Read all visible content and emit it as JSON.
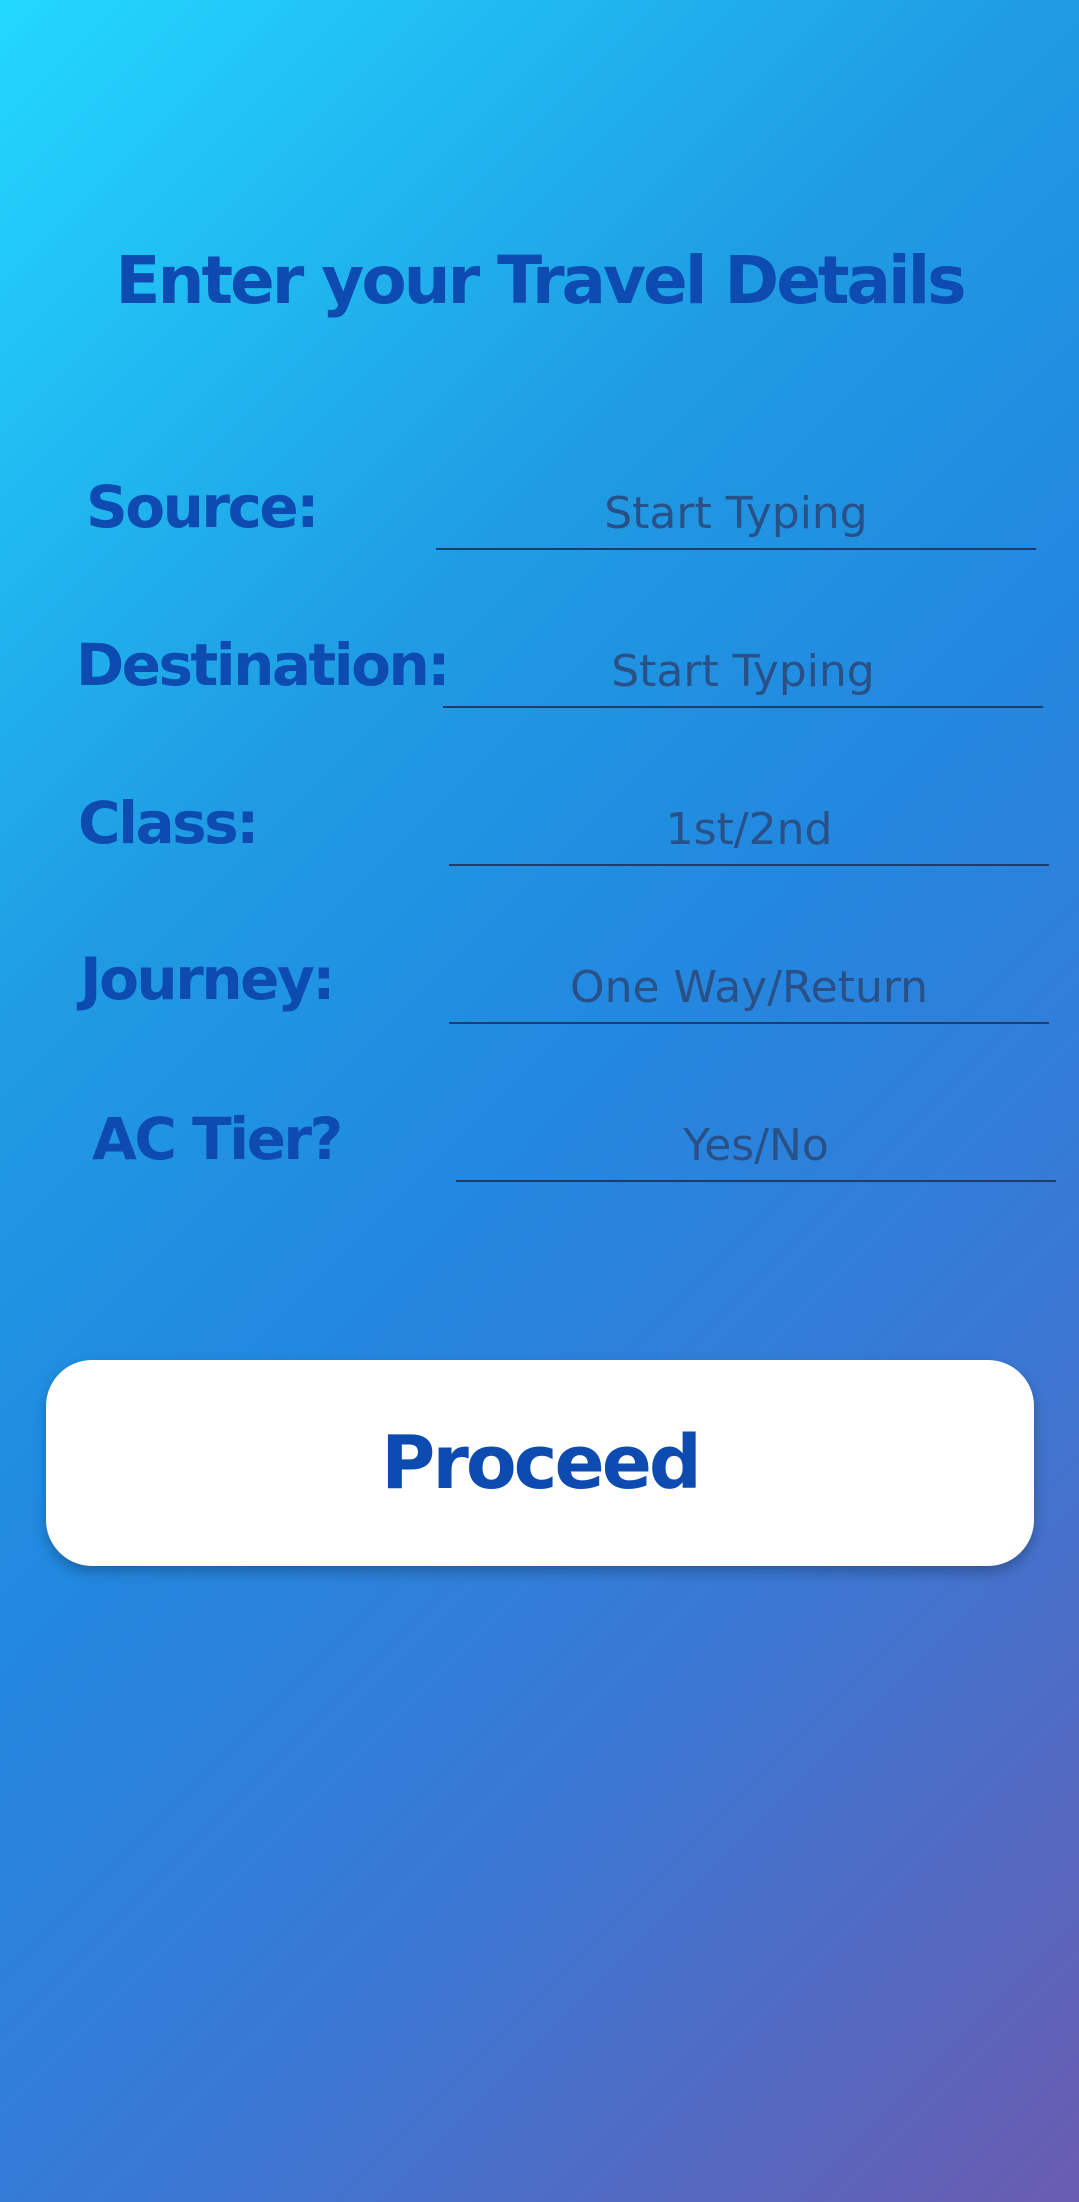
{
  "page": {
    "title": "Enter your Travel Details"
  },
  "form": {
    "source": {
      "label": "Source:",
      "placeholder": "Start Typing",
      "value": ""
    },
    "destination": {
      "label": "Destination:",
      "placeholder": "Start Typing",
      "value": ""
    },
    "class": {
      "label": "Class:",
      "placeholder": "1st/2nd",
      "value": ""
    },
    "journey": {
      "label": "Journey:",
      "placeholder": "One Way/Return",
      "value": ""
    },
    "ac_tier": {
      "label": "AC Tier?",
      "placeholder": "Yes/No",
      "value": ""
    }
  },
  "actions": {
    "proceed_label": "Proceed"
  },
  "colors": {
    "accent": "#0d4bb0",
    "button_bg": "#ffffff",
    "gradient_start": "#22d8ff",
    "gradient_end": "#6a5cb0"
  }
}
